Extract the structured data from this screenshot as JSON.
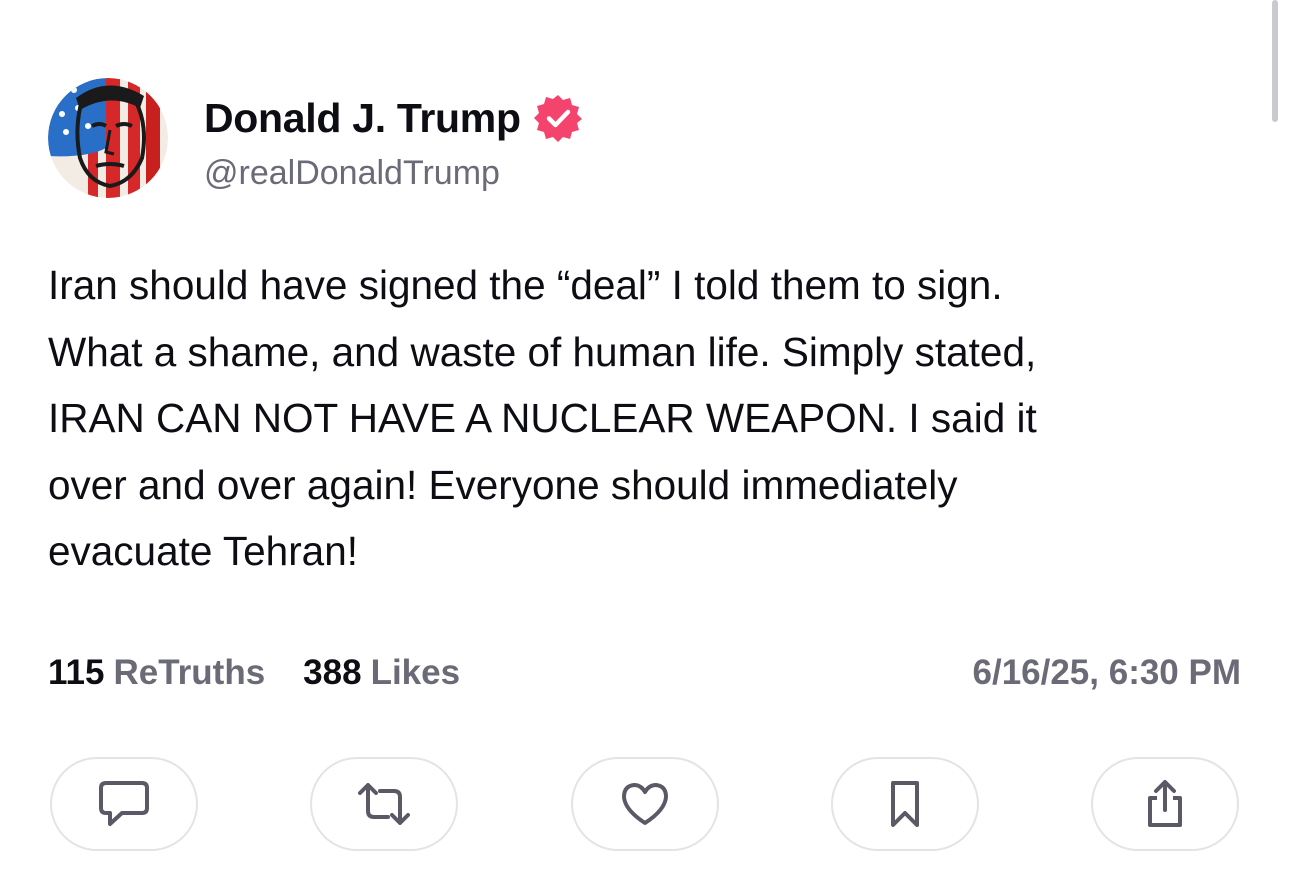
{
  "author": {
    "display_name": "Donald J. Trump",
    "handle": "@realDonaldTrump",
    "verified": true,
    "verified_color": "#f4436c",
    "avatar_icon": "avatar-flag-portrait"
  },
  "post": {
    "lines": [
      "Iran should have signed the “deal” I told them to sign.",
      "What a shame, and waste of human life. Simply stated,",
      "IRAN CAN NOT HAVE A NUCLEAR WEAPON. I said it",
      "over and over again! Everyone should immediately",
      "evacuate Tehran!"
    ]
  },
  "stats": {
    "retruths_count": "115",
    "retruths_label": "ReTruths",
    "likes_count": "388",
    "likes_label": "Likes",
    "timestamp": "6/16/25, 6:30 PM"
  },
  "actions": [
    {
      "name": "reply",
      "icon": "comment-icon"
    },
    {
      "name": "retruth",
      "icon": "repost-icon"
    },
    {
      "name": "like",
      "icon": "heart-icon"
    },
    {
      "name": "bookmark",
      "icon": "bookmark-icon"
    },
    {
      "name": "share",
      "icon": "share-icon"
    }
  ],
  "colors": {
    "text_primary": "#0d0d14",
    "text_secondary": "#6b6b78",
    "icon": "#5a5a66",
    "button_border": "#e3e3e8"
  }
}
